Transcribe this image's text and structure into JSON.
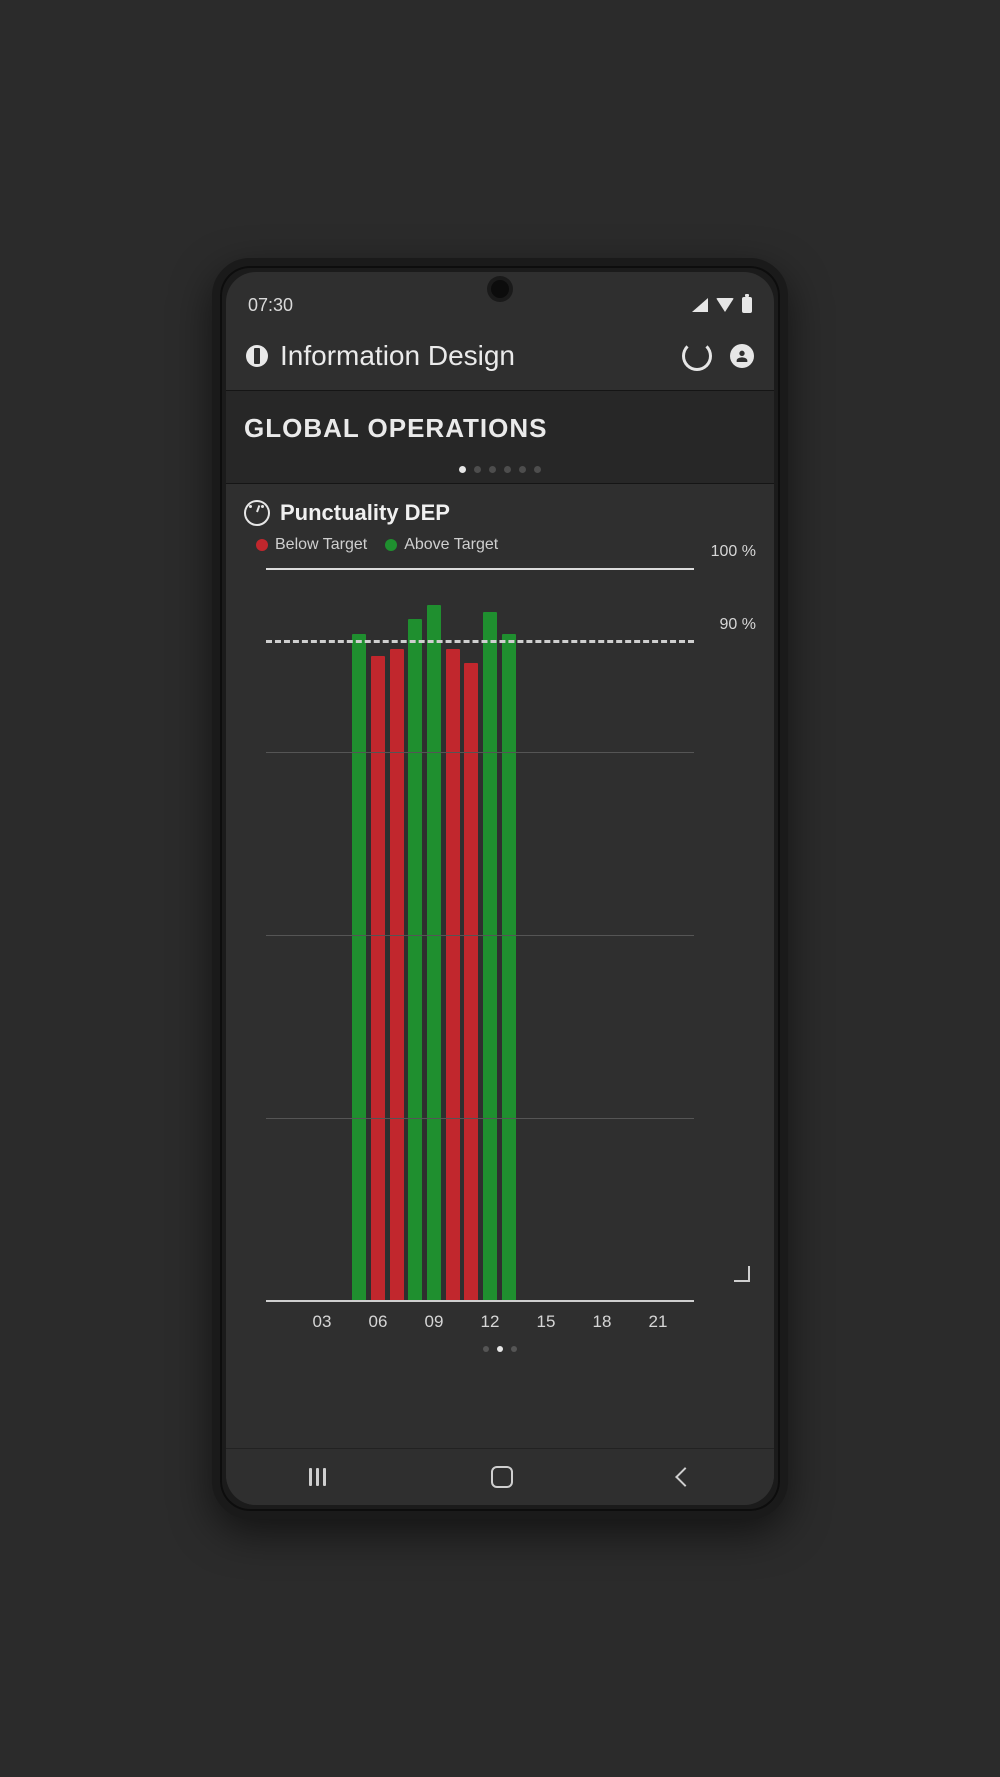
{
  "status": {
    "time": "07:30"
  },
  "app": {
    "title": "Information Design",
    "loading": true
  },
  "section": {
    "title": "GLOBAL OPERATIONS",
    "page_active": 0,
    "page_count": 6
  },
  "card": {
    "title": "Punctuality DEP",
    "legend": {
      "below": "Below Target",
      "above": "Above Target"
    },
    "page_active": 1,
    "page_count": 3
  },
  "chart_data": {
    "type": "bar",
    "ylabel": "",
    "xlabel": "",
    "ylim": [
      0,
      100
    ],
    "target_line": 90,
    "y_ticks": [
      100,
      90
    ],
    "y_tick_labels": [
      "100 %",
      "90 %"
    ],
    "x_ticks": [
      "03",
      "06",
      "09",
      "12",
      "15",
      "18",
      "21"
    ],
    "series": [
      {
        "name": "Below Target",
        "color": "#c1272d"
      },
      {
        "name": "Above Target",
        "color": "#1f8f2f"
      }
    ],
    "points": [
      {
        "hour": "05",
        "value": 91,
        "status": "above"
      },
      {
        "hour": "06",
        "value": 88,
        "status": "below"
      },
      {
        "hour": "07",
        "value": 89,
        "status": "below"
      },
      {
        "hour": "08",
        "value": 93,
        "status": "above"
      },
      {
        "hour": "09",
        "value": 95,
        "status": "above"
      },
      {
        "hour": "10",
        "value": 89,
        "status": "below"
      },
      {
        "hour": "11",
        "value": 87,
        "status": "below"
      },
      {
        "hour": "12",
        "value": 94,
        "status": "above"
      },
      {
        "hour": "13",
        "value": 91,
        "status": "above"
      }
    ]
  }
}
